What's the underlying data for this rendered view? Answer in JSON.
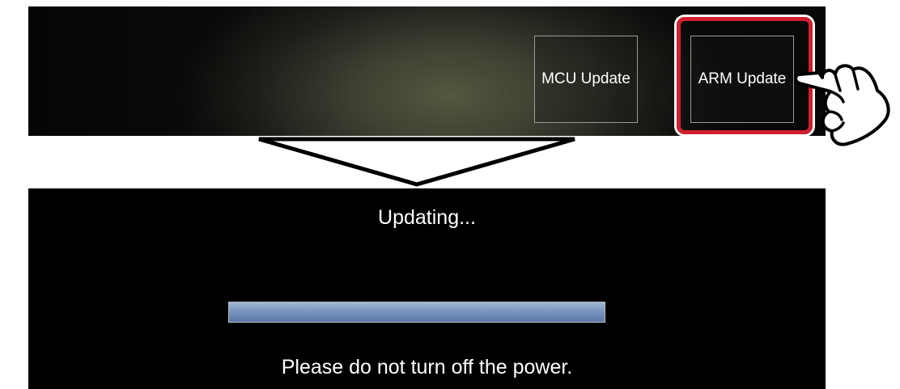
{
  "top_screen": {
    "buttons": [
      {
        "label": "MCU Update",
        "icon": null
      },
      {
        "label": "ARM Update",
        "icon": null
      }
    ],
    "highlight_color": "#d0202e",
    "pointer_icon": "pointing-hand-icon"
  },
  "transition_arrow_icon": "down-arrow-icon",
  "bottom_screen": {
    "status_text": "Updating...",
    "progress": 1.0,
    "progress_color": "#7a95be",
    "warning_text": "Please do not turn off the power."
  }
}
